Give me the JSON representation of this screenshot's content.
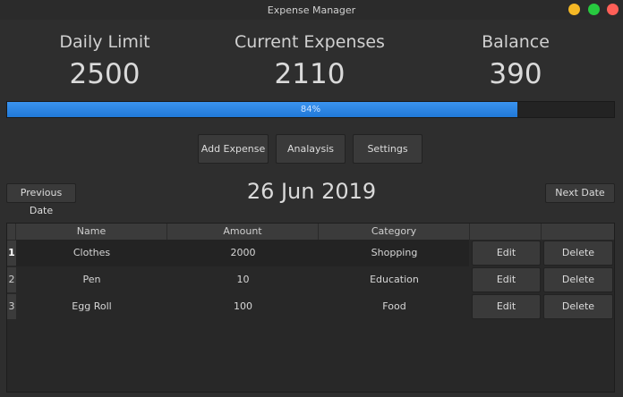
{
  "window": {
    "title": "Expense Manager"
  },
  "stats": {
    "daily_limit": {
      "label": "Daily Limit",
      "value": "2500"
    },
    "current_expenses": {
      "label": "Current Expenses",
      "value": "2110"
    },
    "balance": {
      "label": "Balance",
      "value": "390"
    }
  },
  "progress": {
    "percent": 84,
    "text": "84%",
    "color": "#2a86e6"
  },
  "toolbar": {
    "add_label": "Add Expense",
    "analysis_label": "Analaysis",
    "settings_label": "Settings"
  },
  "date_nav": {
    "prev_label": "Previous Date",
    "next_label": "Next Date",
    "current_date": "26 Jun 2019"
  },
  "table": {
    "columns": [
      "Name",
      "Amount",
      "Category",
      "",
      ""
    ],
    "rows": [
      {
        "num": "1",
        "name": "Clothes",
        "amount": "2000",
        "category": "Shopping",
        "edit": "Edit",
        "delete": "Delete"
      },
      {
        "num": "2",
        "name": "Pen",
        "amount": "10",
        "category": "Education",
        "edit": "Edit",
        "delete": "Delete"
      },
      {
        "num": "3",
        "name": "Egg Roll",
        "amount": "100",
        "category": "Food",
        "edit": "Edit",
        "delete": "Delete"
      }
    ]
  }
}
